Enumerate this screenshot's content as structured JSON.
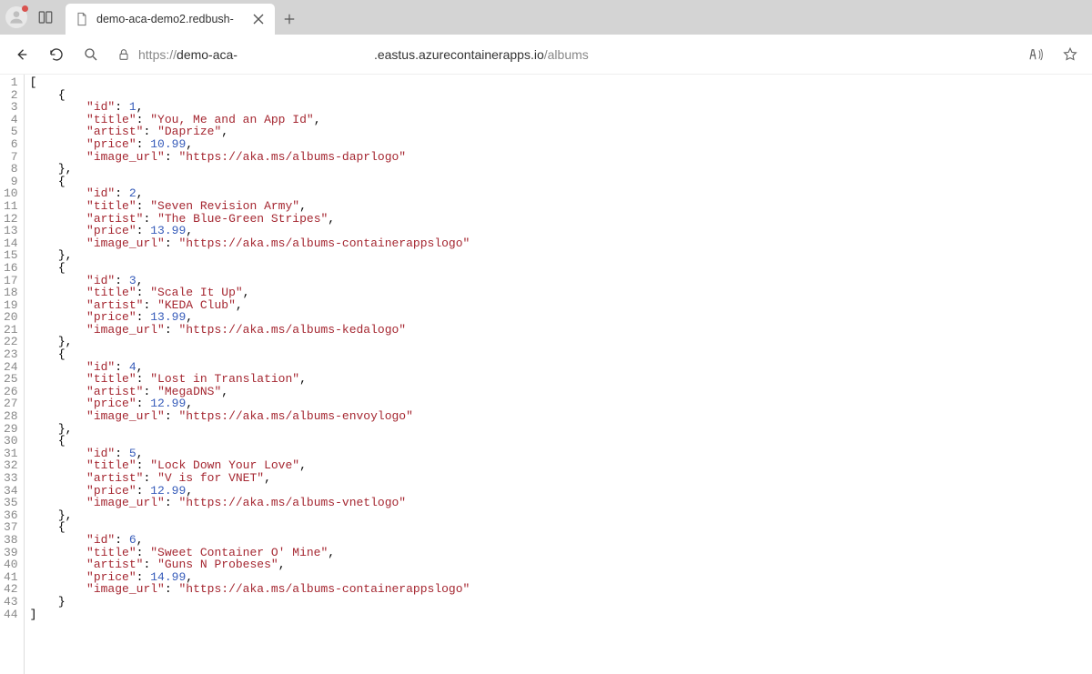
{
  "browser": {
    "tab_title": "demo-aca-demo2.redbush-",
    "url_prefix": "https://",
    "url_host_obscured1": "demo-aca-",
    "url_host_obscured2": ".eastus.azurecontainerapps.io",
    "url_path": "/albums"
  },
  "json": {
    "albums": [
      {
        "id": 1,
        "title": "You, Me and an App Id",
        "artist": "Daprize",
        "price": 10.99,
        "image_url": "https://aka.ms/albums-daprlogo"
      },
      {
        "id": 2,
        "title": "Seven Revision Army",
        "artist": "The Blue-Green Stripes",
        "price": 13.99,
        "image_url": "https://aka.ms/albums-containerappslogo"
      },
      {
        "id": 3,
        "title": "Scale It Up",
        "artist": "KEDA Club",
        "price": 13.99,
        "image_url": "https://aka.ms/albums-kedalogo"
      },
      {
        "id": 4,
        "title": "Lost in Translation",
        "artist": "MegaDNS",
        "price": 12.99,
        "image_url": "https://aka.ms/albums-envoylogo"
      },
      {
        "id": 5,
        "title": "Lock Down Your Love",
        "artist": "V is for VNET",
        "price": 12.99,
        "image_url": "https://aka.ms/albums-vnetlogo"
      },
      {
        "id": 6,
        "title": "Sweet Container O' Mine",
        "artist": "Guns N Probeses",
        "price": 14.99,
        "image_url": "https://aka.ms/albums-containerappslogo"
      }
    ]
  }
}
